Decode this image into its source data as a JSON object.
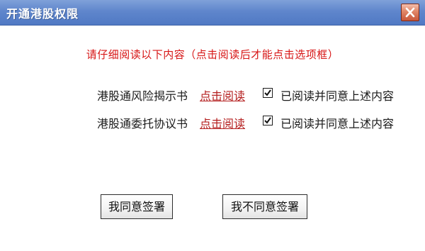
{
  "window": {
    "title": "开通港股权限"
  },
  "notice": "请仔细阅读以下内容（点击阅读后才能点击选项框）",
  "documents": [
    {
      "name": "港股通风险揭示书",
      "link_label": "点击阅读",
      "agree_label": "已阅读并同意上述内容",
      "checked": true
    },
    {
      "name": "港股通委托协议书",
      "link_label": "点击阅读",
      "agree_label": "已阅读并同意上述内容",
      "checked": true
    }
  ],
  "buttons": {
    "agree_label": "我同意签署",
    "disagree_label": "我不同意签署"
  },
  "colors": {
    "title_bar": "#5f86cc",
    "notice_text": "#d71616",
    "link_text": "#b41e1e",
    "close_button": "#d26a4d"
  }
}
